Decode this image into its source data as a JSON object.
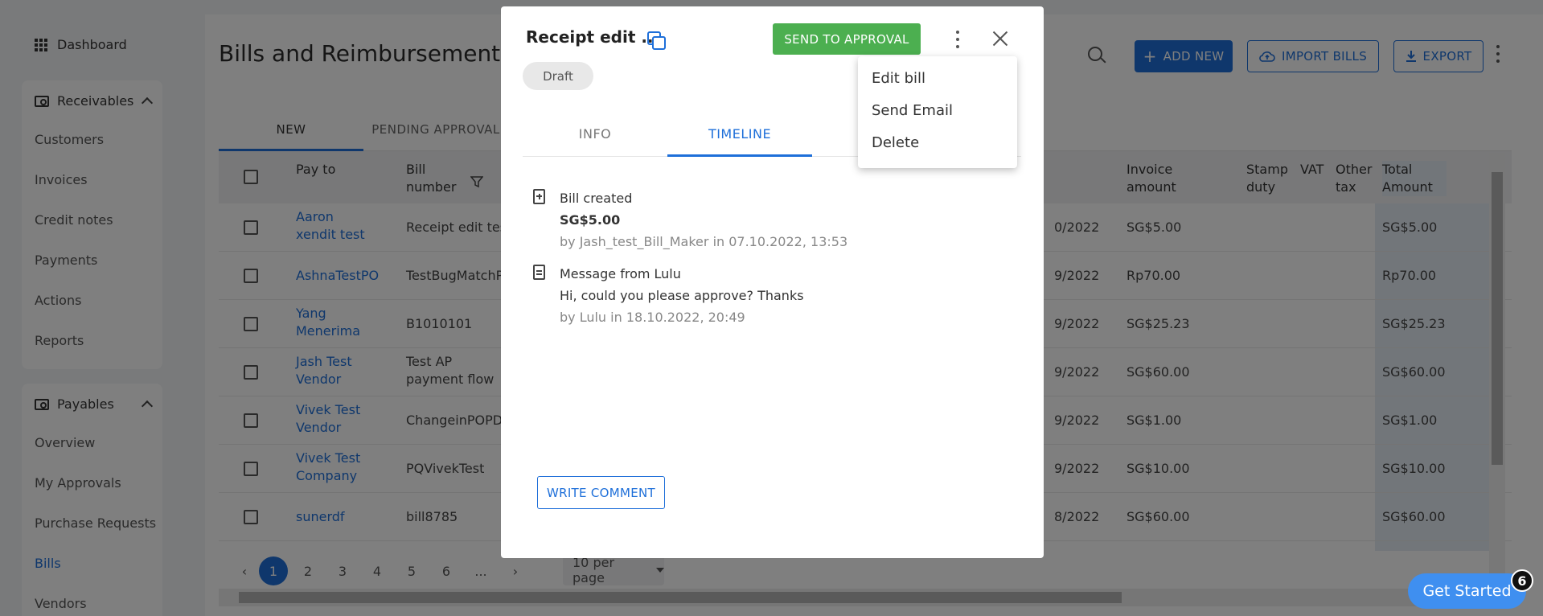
{
  "sidebar": {
    "dashboard": "Dashboard",
    "receivables": {
      "title": "Receivables",
      "items": [
        "Customers",
        "Invoices",
        "Credit notes",
        "Payments",
        "Actions",
        "Reports"
      ]
    },
    "payables": {
      "title": "Payables",
      "items": [
        "Overview",
        "My Approvals",
        "Purchase Requests",
        "Bills",
        "Vendors"
      ],
      "active": "Bills"
    }
  },
  "header": {
    "title": "Bills and Reimbursements",
    "add_new": "ADD NEW",
    "import_bills": "IMPORT BILLS",
    "export": "EXPORT"
  },
  "tabs": [
    "NEW",
    "PENDING APPROVAL"
  ],
  "table": {
    "headers": {
      "pay_to": "Pay to",
      "bill_number": "Bill number",
      "invoice_amount": "Invoice amount",
      "stamp_duty": "Stamp duty",
      "vat": "VAT",
      "other_tax": "Other tax",
      "total_amount": "Total Amount"
    },
    "rows": [
      {
        "pay_to": "Aaron xendit test",
        "bill": "Receipt edit test",
        "date": "0/2022",
        "invoice": "SG$5.00",
        "total": "SG$5.00"
      },
      {
        "pay_to": "AshnaTestPO",
        "bill": "TestBugMatchPO",
        "date": "9/2022",
        "invoice": "Rp70.00",
        "total": "Rp70.00"
      },
      {
        "pay_to": "Yang Menerima",
        "bill": "B1010101",
        "date": "9/2022",
        "invoice": "SG$25.23",
        "total": "SG$25.23"
      },
      {
        "pay_to": "Jash Test Vendor",
        "bill": "Test AP payment flow",
        "date": "9/2022",
        "invoice": "SG$60.00",
        "total": "SG$60.00"
      },
      {
        "pay_to": "Vivek Test Vendor",
        "bill": "ChangeinPOPDF",
        "date": "9/2022",
        "invoice": "SG$1.00",
        "total": "SG$1.00"
      },
      {
        "pay_to": "Vivek Test Company",
        "bill": "PQVivekTest",
        "date": "9/2022",
        "invoice": "SG$10.00",
        "total": "SG$10.00"
      },
      {
        "pay_to": "sunerdf",
        "bill": "bill8785",
        "date": "8/2022",
        "invoice": "SG$60.00",
        "total": "SG$60.00"
      }
    ]
  },
  "pagination": {
    "pages": [
      "1",
      "2",
      "3",
      "4",
      "5",
      "6",
      "..."
    ],
    "current": "1",
    "per_page": "10 per page"
  },
  "modal": {
    "title": "Receipt edit ...",
    "send_to_approval": "SEND TO APPROVAL",
    "status": "Draft",
    "tabs": {
      "info": "INFO",
      "timeline": "TIMELINE"
    },
    "timeline": [
      {
        "title": "Bill created",
        "amount": "SG$5.00",
        "meta": "by Jash_test_Bill_Maker in 07.10.2022, 13:53"
      },
      {
        "title": "Message from Lulu",
        "message": "Hi, could you please approve? Thanks",
        "meta": "by Lulu in 18.10.2022, 20:49"
      }
    ],
    "write_comment": "WRITE COMMENT"
  },
  "menu": {
    "items": [
      "Edit bill",
      "Send Email",
      "Delete"
    ]
  },
  "get_started": {
    "label": "Get Started",
    "badge": "6"
  },
  "colors": {
    "accent": "#1e6fd9",
    "approval": "#4caf50"
  }
}
